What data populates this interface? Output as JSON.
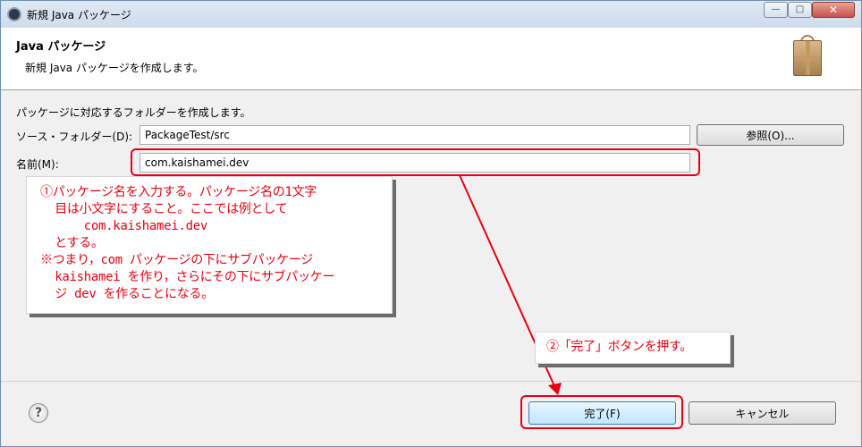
{
  "window": {
    "title": "新規 Java パッケージ",
    "close_label": "✕",
    "max_label": "□",
    "min_label": "—"
  },
  "header": {
    "title": "Java パッケージ",
    "description": "新規 Java パッケージを作成します。",
    "icon": "package-icon"
  },
  "form": {
    "info": "パッケージに対応するフォルダーを作成します。",
    "source_label": "ソース・フォルダー(D):",
    "source_value": "PackageTest/src",
    "browse_label": "参照(O)...",
    "name_label": "名前(M):",
    "name_value": "com.kaishamei.dev"
  },
  "buttons": {
    "help_label": "?",
    "finish_label": "完了(F)",
    "cancel_label": "キャンセル"
  },
  "annotations": {
    "callout1": [
      "①パッケージ名を入力する。パッケージ名の1文字",
      "  目は小文字にすること。ここでは例として",
      "      com.kaishamei.dev",
      "  とする。",
      "※つまり，com パッケージの下にサブパッケージ",
      "  kaishamei を作り，さらにその下にサブパッケー",
      "  ジ dev を作ることになる。"
    ],
    "callout2": "②「完了」ボタンを押す。",
    "accent_color": "#e60012"
  }
}
